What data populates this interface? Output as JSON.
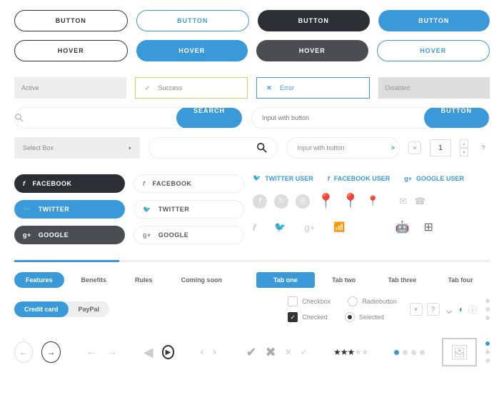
{
  "buttons_r1": [
    "BUTTON",
    "BUTTON",
    "BUTTON",
    "BUTTON"
  ],
  "buttons_r2": [
    "HOVER",
    "HOVER",
    "HOVER",
    "HOVER"
  ],
  "fields": {
    "active": "Active",
    "success": "Success",
    "error": "Error",
    "disabled": "Disabled"
  },
  "search": {
    "btn": "SEARCH"
  },
  "inputBtn": {
    "placeholder": "Input with button",
    "btn": "BUTTON"
  },
  "select": "Select Box",
  "miniInput": {
    "placeholder": "Input with button"
  },
  "qty": {
    "value": "1",
    "help": "?"
  },
  "social": {
    "fb": "FACEBOOK",
    "tw": "TWITTER",
    "gg": "GOOGLE"
  },
  "socialLinks": {
    "tw": "TWITTER USER",
    "fb": "FACEBOOK USER",
    "gg": "GOOGLE USER"
  },
  "tabs1": [
    "Features",
    "Benefits",
    "Rules",
    "Coming soon"
  ],
  "tabs2": [
    "Tab one",
    "Tab two",
    "Tab three",
    "Tab four"
  ],
  "pills": [
    "Credit card",
    "PayPal"
  ],
  "checks": {
    "cb": "Checkbox",
    "cbon": "Checked",
    "rb": "Radiobutton",
    "rbon": "Selected"
  },
  "x": "×",
  "q": "?",
  "chev": ">"
}
